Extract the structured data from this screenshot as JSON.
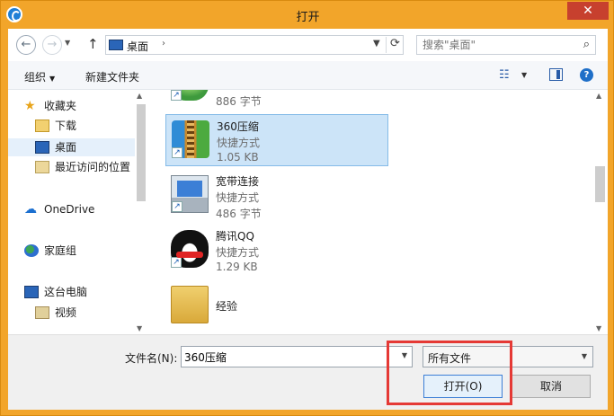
{
  "window": {
    "title": "打开",
    "close_glyph": "✕"
  },
  "address": {
    "location": "桌面",
    "search_placeholder": "搜索\"桌面\""
  },
  "toolbar": {
    "organize": "组织",
    "new_folder": "新建文件夹"
  },
  "nav": {
    "items": [
      {
        "label": "收藏夹",
        "icon": "star-icon"
      },
      {
        "label": "下载",
        "icon": "download-folder-icon"
      },
      {
        "label": "桌面",
        "icon": "desktop-icon",
        "selected": true
      },
      {
        "label": "最近访问的位置",
        "icon": "recent-places-icon"
      },
      {
        "label": "OneDrive",
        "icon": "cloud-icon"
      },
      {
        "label": "家庭组",
        "icon": "homegroup-icon"
      },
      {
        "label": "这台电脑",
        "icon": "computer-icon"
      },
      {
        "label": "视频",
        "icon": "video-folder-icon"
      }
    ]
  },
  "files": [
    {
      "name": "",
      "type": "",
      "size": "886 字节",
      "icon": "shield-icon",
      "shortcut": true
    },
    {
      "name": "360压缩",
      "type": "快捷方式",
      "size": "1.05 KB",
      "icon": "zip-archive-icon",
      "shortcut": true,
      "selected": true
    },
    {
      "name": "宽带连接",
      "type": "快捷方式",
      "size": "486 字节",
      "icon": "network-connection-icon",
      "shortcut": true
    },
    {
      "name": "腾讯QQ",
      "type": "快捷方式",
      "size": "1.29 KB",
      "icon": "qq-penguin-icon",
      "shortcut": true
    },
    {
      "name": "经验",
      "type": "",
      "size": "",
      "icon": "folder-icon",
      "shortcut": false
    }
  ],
  "bottom": {
    "filename_label": "文件名(N):",
    "filename_value": "360压缩",
    "filter_value": "所有文件",
    "open_label": "打开(O)",
    "cancel_label": "取消"
  },
  "colors": {
    "window_frame": "#f2a52a",
    "selection": "#cce4f8",
    "highlight_box": "#e53935"
  }
}
